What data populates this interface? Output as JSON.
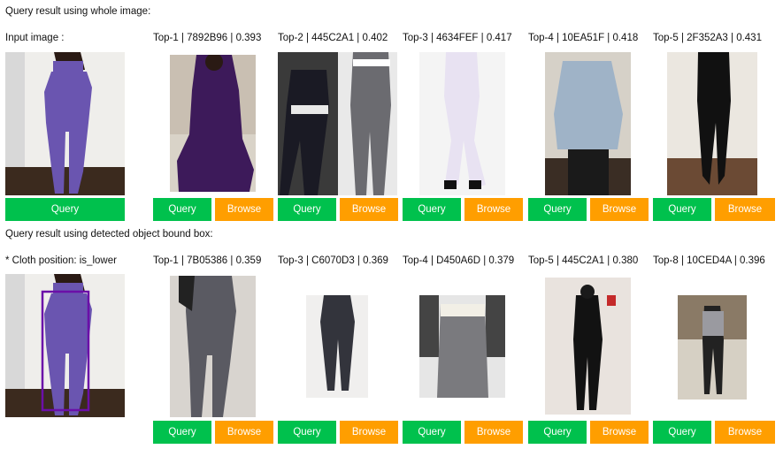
{
  "section1": {
    "title": "Query result using whole image:",
    "input_label": "Input image :",
    "results": [
      {
        "label": "Top-1 | 7892B96 | 0.393"
      },
      {
        "label": "Top-2 | 445C2A1 | 0.402"
      },
      {
        "label": "Top-3 | 4634FEF | 0.417"
      },
      {
        "label": "Top-4 | 10EA51F | 0.418"
      },
      {
        "label": "Top-5 | 2F352A3 | 0.431"
      }
    ]
  },
  "section2": {
    "title": "Query result using detected object bound box:",
    "input_label": "* Cloth position: is_lower",
    "results": [
      {
        "label": "Top-1 | 7B05386 | 0.359"
      },
      {
        "label": "Top-3 | C6070D3 | 0.369"
      },
      {
        "label": "Top-4 | D450A6D | 0.379"
      },
      {
        "label": "Top-5 | 445C2A1 | 0.380"
      },
      {
        "label": "Top-8 | 10CED4A | 0.396"
      }
    ]
  },
  "buttons": {
    "query": "Query",
    "browse": "Browse"
  },
  "colors": {
    "query": "#00c14d",
    "browse": "#ff9e00",
    "bbox": "#6b0fa8"
  }
}
